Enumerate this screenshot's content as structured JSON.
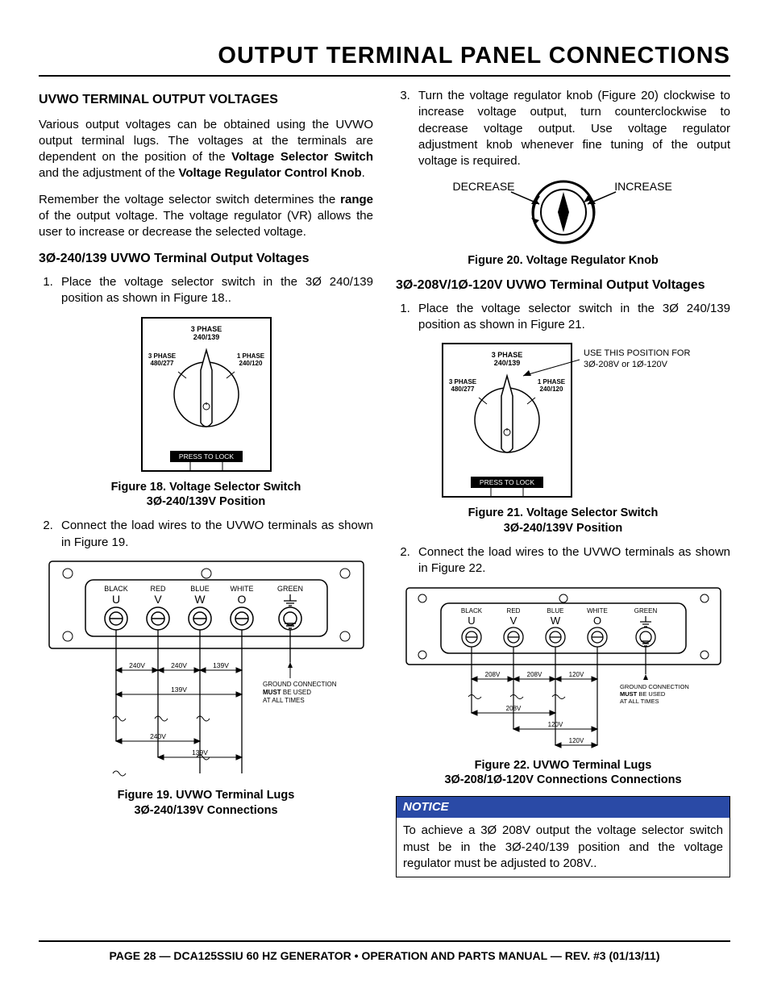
{
  "pageTitle": "OUTPUT TERMINAL PANEL CONNECTIONS",
  "left": {
    "sectionHead": "UVWO TERMINAL OUTPUT VOLTAGES",
    "p1a": "Various output voltages can be obtained using the UVWO output terminal lugs. The voltages at the terminals are dependent on the position of the ",
    "p1b": "Voltage Selector Switch",
    "p1c": " and the adjustment of the ",
    "p1d": "Voltage Regulator Control Knob",
    "p1e": ".",
    "p2a": "Remember the voltage selector switch determines the ",
    "p2b": "range",
    "p2c": " of the output voltage. The voltage regulator (VR) allows the user to increase or decrease the selected voltage.",
    "subHead": "3Ø-240/139 UVWO Terminal Output Voltages",
    "li1": "Place the voltage selector switch in the 3Ø 240/139 position as shown in Figure 18..",
    "fig18_sw": {
      "top": "3 PHASE",
      "topV": "240/139",
      "left": "3 PHASE",
      "leftV": "480/277",
      "right": "1 PHASE",
      "rightV": "240/120",
      "lock": "PRESS TO LOCK"
    },
    "fig18cap": "Figure 18. Voltage Selector Switch\n3Ø-240/139V Position",
    "li2": "Connect the load wires to the UVWO terminals as shown in Figure 19.",
    "fig19": {
      "labels": [
        "BLACK",
        "RED",
        "BLUE",
        "WHITE",
        "GREEN"
      ],
      "letters": [
        "U",
        "V",
        "W",
        "O",
        ""
      ],
      "v1": "240V",
      "v2": "240V",
      "v3": "139V",
      "vn1": "139V",
      "vl1": "240V",
      "vl2": "139V",
      "gnd": "GROUND CONNECTION\nMUST BE USED\nAT ALL TIMES"
    },
    "fig19cap": "Figure 19.  UVWO Terminal Lugs\n3Ø-240/139V Connections"
  },
  "right": {
    "li3": "Turn the voltage regulator knob (Figure 20) clockwise to increase voltage output, turn counterclockwise to decrease voltage output. Use voltage regulator adjustment knob whenever fine tuning of the output voltage is required.",
    "knob": {
      "dec": "DECREASE",
      "inc": "INCREASE"
    },
    "fig20cap": "Figure 20. Voltage Regulator Knob",
    "subHead": "3Ø-208V/1Ø-120V UVWO Terminal Output Voltages",
    "li1": "Place the voltage selector switch in the 3Ø 240/139 position as shown in Figure 21.",
    "fig21_sw": {
      "top": "3 PHASE",
      "topV": "240/139",
      "left": "3 PHASE",
      "leftV": "480/277",
      "right": "1 PHASE",
      "rightV": "240/120",
      "lock": "PRESS TO LOCK",
      "note1": "USE THIS POSITION FOR",
      "note2": "3Ø-208V or 1Ø-120V"
    },
    "fig21cap": "Figure 21. Voltage Selector Switch\n3Ø-240/139V Position",
    "li2": "Connect the load wires to the UVWO terminals as shown in Figure 22.",
    "fig22": {
      "labels": [
        "BLACK",
        "RED",
        "BLUE",
        "WHITE",
        "GREEN"
      ],
      "letters": [
        "U",
        "V",
        "W",
        "O",
        ""
      ],
      "v1": "208V",
      "v2": "208V",
      "v3": "120V",
      "vl1": "208V",
      "vl2": "120V",
      "vl3": "120V",
      "gnd": "GROUND CONNECTION\nMUST BE USED\nAT ALL TIMES"
    },
    "fig22cap": "Figure 22. UVWO Terminal Lugs\n3Ø-208/1Ø-120V Connections Connections",
    "notice": {
      "hdr": "NOTICE",
      "body": "To achieve a 3Ø 208V output  the voltage selector switch must be in the 3Ø-240/139 position and the voltage regulator must be adjusted to 208V.."
    }
  },
  "footer": "PAGE 28 — DCA125SSIU 60 HZ GENERATOR • OPERATION AND PARTS MANUAL — REV. #3 (01/13/11)"
}
